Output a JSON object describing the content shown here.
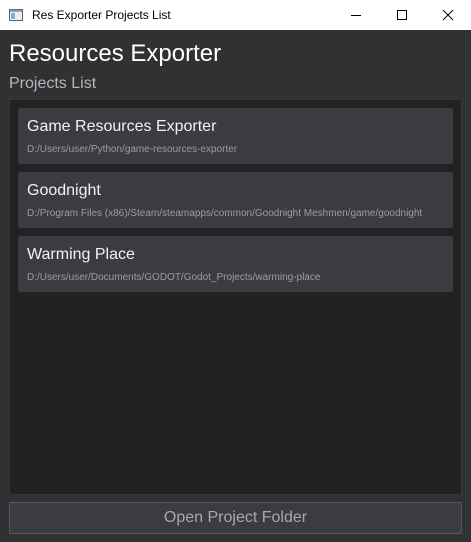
{
  "window": {
    "title": "Res Exporter Projects List"
  },
  "header": {
    "title": "Resources Exporter",
    "subtitle": "Projects List"
  },
  "projects": [
    {
      "name": "Game Resources Exporter",
      "path": "D:/Users/user/Python/game-resources-exporter"
    },
    {
      "name": "Goodnight",
      "path": "D:/Program Files (x86)/Steam/steamapps/common/Goodnight Meshmen/game/goodnight"
    },
    {
      "name": "Warming Place",
      "path": "D:/Users/user/Documents/GODOT/Godot_Projects/warming-place"
    }
  ],
  "footer": {
    "open_button_label": "Open Project Folder"
  },
  "colors": {
    "background": "#2f3133",
    "panel": "#202224",
    "item": "#3a3c3f"
  }
}
